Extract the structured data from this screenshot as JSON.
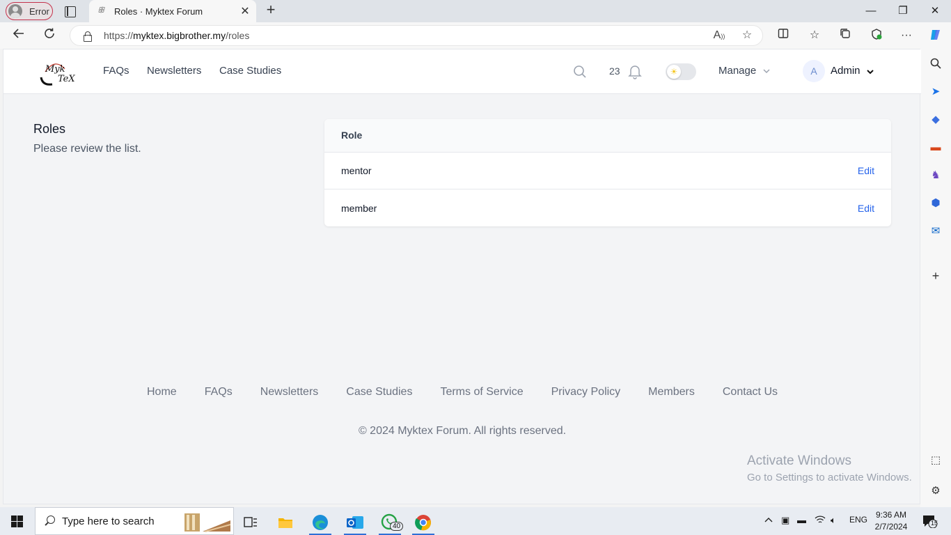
{
  "browser": {
    "profile_label": "Error",
    "tab_title": "Roles · Myktex Forum",
    "tab_favicon": "ꕥ",
    "url_prefix": "https://",
    "url_host": "myktex.bigbrother.my",
    "url_path": "/roles",
    "read_aloud_label": "A",
    "window_controls": {
      "minimize": "—",
      "maximize": "❐",
      "close": "✕"
    }
  },
  "header": {
    "logo_text_top": "Myk",
    "logo_text_bottom": "TeX",
    "nav": [
      "FAQs",
      "Newsletters",
      "Case Studies"
    ],
    "notification_count": "23",
    "manage_label": "Manage",
    "user_initial": "A",
    "user_name": "Admin"
  },
  "main": {
    "title": "Roles",
    "description": "Please review the list.",
    "table_header": "Role",
    "rows": [
      {
        "role": "mentor",
        "action": "Edit"
      },
      {
        "role": "member",
        "action": "Edit"
      }
    ]
  },
  "footer": {
    "links": [
      "Home",
      "FAQs",
      "Newsletters",
      "Case Studies",
      "Terms of Service",
      "Privacy Policy",
      "Members",
      "Contact Us"
    ],
    "copyright": "© 2024 Myktex Forum. All rights reserved."
  },
  "watermark": {
    "line1": "Activate Windows",
    "line2": "Go to Settings to activate Windows."
  },
  "taskbar": {
    "search_placeholder": "Type here to search",
    "whatsapp_badge": "40",
    "language": "ENG",
    "time": "9:36 AM",
    "date": "2/7/2024",
    "notification_count": "15"
  },
  "colors": {
    "accent": "#2563eb",
    "page_bg": "#f3f4f6",
    "header_bg": "#ffffff",
    "error_outline": "#c4314b"
  }
}
